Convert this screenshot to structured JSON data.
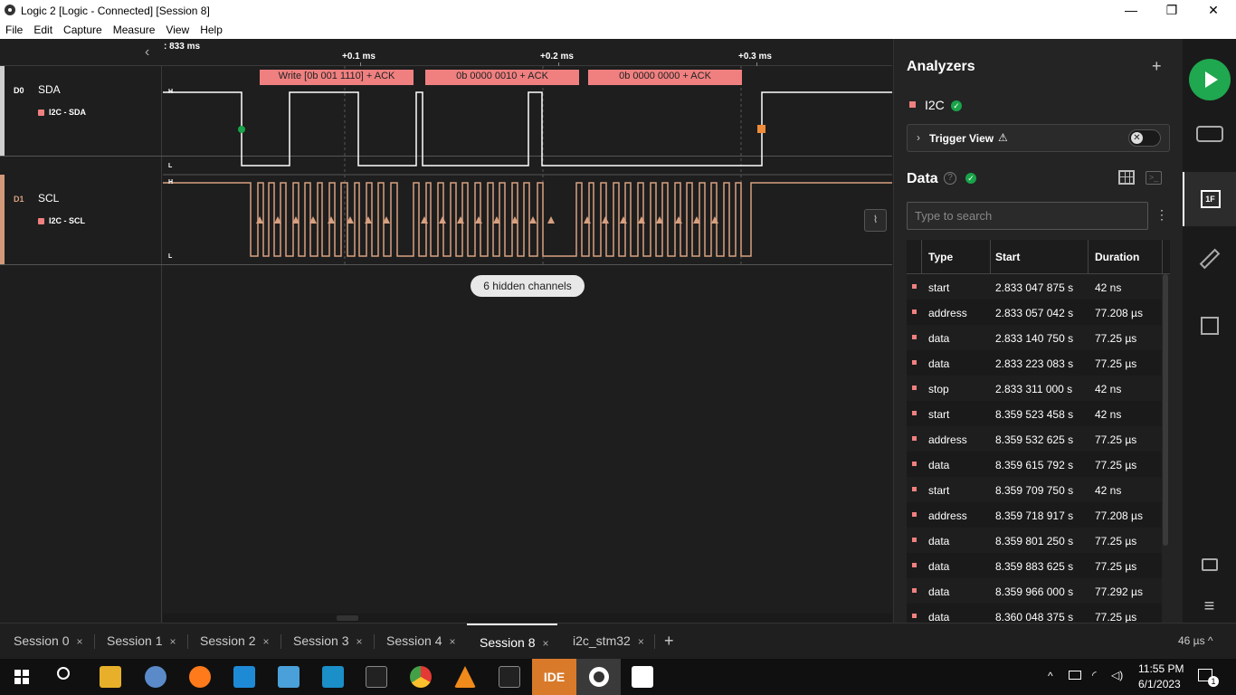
{
  "window": {
    "title": "Logic 2 [Logic - Connected] [Session 8]",
    "min": "—",
    "restore": "❐",
    "close": "✕"
  },
  "menu": [
    "File",
    "Edit",
    "Capture",
    "Measure",
    "View",
    "Help"
  ],
  "timeline": {
    "origin": ": 833 ms",
    "ticks": [
      {
        "label": "+0.1 ms"
      },
      {
        "label": "+0.2 ms"
      },
      {
        "label": "+0.3 ms"
      }
    ]
  },
  "channels": [
    {
      "index": "D0",
      "name": "SDA",
      "analyzer": "I2C - SDA",
      "color": "#ffffff",
      "bar_color": "#cfcfcf"
    },
    {
      "index": "D1",
      "name": "SCL",
      "analyzer": "I2C - SCL",
      "color": "#d8a080",
      "bar_color": "#d29a78"
    }
  ],
  "levels": {
    "high": "H",
    "low": "L"
  },
  "decoded_frames": [
    "Write [0b 001 1110] + ACK",
    "0b 0000 0010 + ACK",
    "0b 0000 0000 + ACK"
  ],
  "hidden_channels": "6 hidden channels",
  "panel": {
    "analyzers_title": "Analyzers",
    "add": "+",
    "analyzer_name": "I2C",
    "trigger_view": "Trigger View",
    "data_title": "Data",
    "search_placeholder": "Type to search",
    "columns": [
      "Type",
      "Start",
      "Duration"
    ],
    "rows": [
      {
        "type": "start",
        "start": "2.833 047 875 s",
        "duration": "42 ns"
      },
      {
        "type": "address",
        "start": "2.833 057 042 s",
        "duration": "77.208 µs"
      },
      {
        "type": "data",
        "start": "2.833 140 750 s",
        "duration": "77.25 µs"
      },
      {
        "type": "data",
        "start": "2.833 223 083 s",
        "duration": "77.25 µs"
      },
      {
        "type": "stop",
        "start": "2.833 311 000 s",
        "duration": "42 ns"
      },
      {
        "type": "start",
        "start": "8.359 523 458 s",
        "duration": "42 ns"
      },
      {
        "type": "address",
        "start": "8.359 532 625 s",
        "duration": "77.25 µs"
      },
      {
        "type": "data",
        "start": "8.359 615 792 s",
        "duration": "77.25 µs"
      },
      {
        "type": "start",
        "start": "8.359 709 750 s",
        "duration": "42 ns"
      },
      {
        "type": "address",
        "start": "8.359 718 917 s",
        "duration": "77.208 µs"
      },
      {
        "type": "data",
        "start": "8.359 801 250 s",
        "duration": "77.25 µs"
      },
      {
        "type": "data",
        "start": "8.359 883 625 s",
        "duration": "77.25 µs"
      },
      {
        "type": "data",
        "start": "8.359 966 000 s",
        "duration": "77.292 µs"
      },
      {
        "type": "data",
        "start": "8.360 048 375 s",
        "duration": "77.25 µs"
      }
    ]
  },
  "rail": {
    "info": "1F"
  },
  "session_tabs": [
    {
      "label": "Session 0",
      "active": false
    },
    {
      "label": "Session 1",
      "active": false
    },
    {
      "label": "Session 2",
      "active": false
    },
    {
      "label": "Session 3",
      "active": false
    },
    {
      "label": "Session 4",
      "active": false
    },
    {
      "label": "Session 8",
      "active": true
    },
    {
      "label": "i2c_stm32",
      "active": false
    }
  ],
  "tab_close": "×",
  "tab_add": "+",
  "zoom": "46 µs ^",
  "taskbar": {
    "ide_label": "IDE",
    "time": "11:55 PM",
    "date": "6/1/2023",
    "notifications": "1"
  },
  "colors": {
    "accent_green": "#1fa84f",
    "frame_pink": "#f08080",
    "scl_orange": "#d8a080"
  }
}
